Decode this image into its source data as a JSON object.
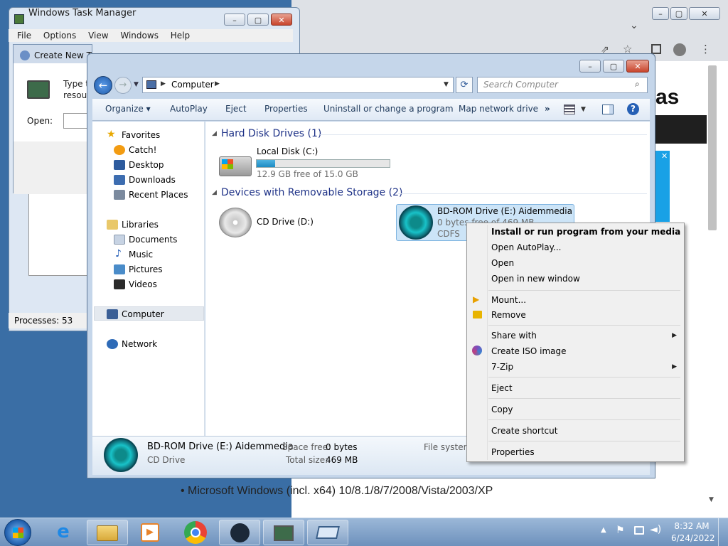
{
  "task_manager": {
    "title": "Windows Task Manager",
    "menu": [
      "File",
      "Options",
      "View",
      "Windows",
      "Help"
    ],
    "status": "Processes: 53"
  },
  "run_dialog": {
    "title": "Create New Ta",
    "line1": "Type t",
    "line2": "resour",
    "open_label": "Open:"
  },
  "browser": {
    "bullet": "Microsoft Windows (incl. x64) 10/8.1/8/7/2008/Vista/2003/XP",
    "logo_fragment": "as"
  },
  "explorer": {
    "address": "Computer",
    "search_placeholder": "Search Computer",
    "toolbar": [
      "Organize",
      "AutoPlay",
      "Eject",
      "Properties",
      "Uninstall or change a program",
      "Map network drive"
    ],
    "nav": {
      "favorites": "Favorites",
      "fav_items": [
        "Catch!",
        "Desktop",
        "Downloads",
        "Recent Places"
      ],
      "libraries": "Libraries",
      "lib_items": [
        "Documents",
        "Music",
        "Pictures",
        "Videos"
      ],
      "computer": "Computer",
      "network": "Network"
    },
    "groups": {
      "hdd": "Hard Disk Drives (1)",
      "removable": "Devices with Removable Storage (2)"
    },
    "local_disk": {
      "name": "Local Disk (C:)",
      "free": "12.9 GB free of 15.0 GB",
      "used_fraction": 0.14
    },
    "cd_drive": {
      "name": "CD Drive (D:)"
    },
    "bd_drive": {
      "name": "BD-ROM Drive (E:) Aidemmedia",
      "free": "0 bytes free of 469 MB",
      "fs": "CDFS"
    },
    "details": {
      "name": "BD-ROM Drive (E:) Aidemmedia",
      "type": "CD Drive",
      "space_free_label": "Space free:",
      "space_free": "0 bytes",
      "total_label": "Total size:",
      "total": "469 MB",
      "fs_label": "File system"
    }
  },
  "context_menu": {
    "items": [
      "Install or run program from your media",
      "Open AutoPlay...",
      "Open",
      "Open in new window",
      "Mount...",
      "Remove",
      "Share with",
      "Create ISO image",
      "7-Zip",
      "Eject",
      "Copy",
      "Create shortcut",
      "Properties"
    ]
  },
  "taskbar": {
    "time": "8:32 AM",
    "date": "6/24/2022"
  }
}
